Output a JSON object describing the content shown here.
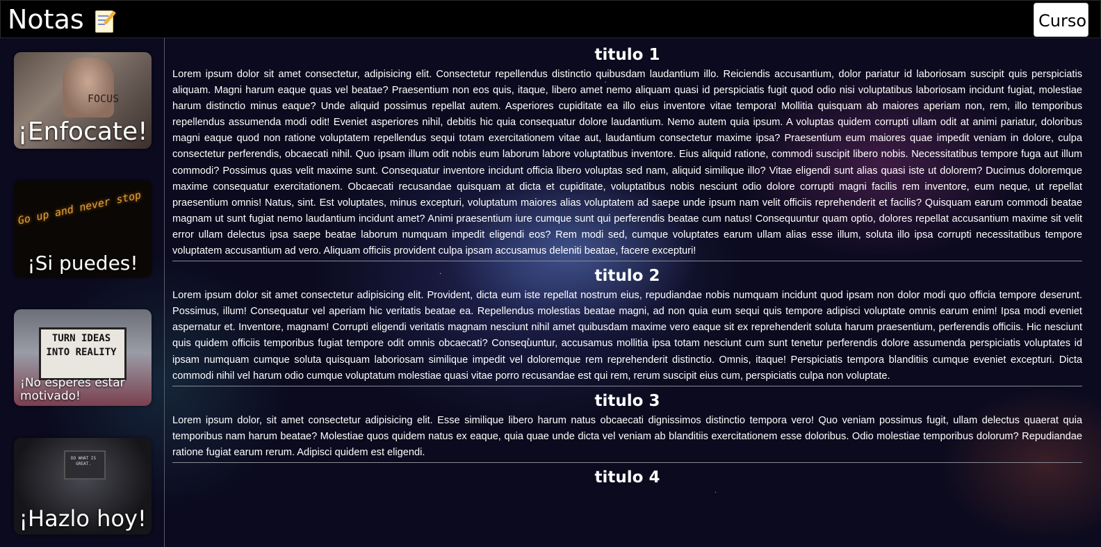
{
  "header": {
    "title": "Notas",
    "title_icon": "memo-icon",
    "course_button": "Curso",
    "background_color": "#000000"
  },
  "sidebar": {
    "cards": [
      {
        "caption": "¡Enfocate!",
        "image_text": "FOCUS",
        "icon": "fist-photo"
      },
      {
        "caption": "¡Si puedes!",
        "image_text": "Go up and never stop",
        "icon": "neon-sign-photo"
      },
      {
        "caption": "¡No esperes estar motivado!",
        "image_text": "TURN IDEAS INTO REALITY",
        "icon": "lightbox-photo"
      },
      {
        "caption": "¡Hazlo hoy!",
        "image_text": "DO WHAT IS GREAT.",
        "icon": "monitor-photo"
      }
    ]
  },
  "notes": [
    {
      "title": "titulo 1",
      "body": "Lorem ipsum dolor sit amet consectetur, adipisicing elit. Consectetur repellendus distinctio quibusdam laudantium illo. Reiciendis accusantium, dolor pariatur id laboriosam suscipit quis perspiciatis aliquam. Magni harum eaque quas vel beatae? Praesentium non eos quis, itaque, libero amet nemo aliquam quasi id perspiciatis fugit quod odio nisi voluptatibus laboriosam incidunt fugiat, molestiae harum distinctio minus eaque? Unde aliquid possimus repellat autem. Asperiores cupiditate ea illo eius inventore vitae tempora! Mollitia quisquam ab maiores aperiam non, rem, illo temporibus repellendus assumenda modi odit! Eveniet asperiores nihil, debitis hic quia consequatur dolore laudantium. Nemo autem quia ipsum. A voluptas quidem corrupti ullam odit at animi pariatur, doloribus magni eaque quod non ratione voluptatem repellendus sequi totam exercitationem vitae aut, laudantium consectetur maxime ipsa? Praesentium eum maiores quae impedit veniam in dolore, culpa consectetur perferendis, obcaecati nihil. Quo ipsam illum odit nobis eum laborum labore voluptatibus inventore. Eius aliquid ratione, commodi suscipit libero nobis. Necessitatibus tempore fuga aut illum commodi? Possimus quas velit maxime sunt. Consequatur inventore incidunt officia libero voluptas sed nam, aliquid similique illo? Vitae eligendi sunt alias quasi iste ut dolorem? Ducimus doloremque maxime consequatur exercitationem. Obcaecati recusandae quisquam at dicta et cupiditate, voluptatibus nobis nesciunt odio dolore corrupti magni facilis rem inventore, eum neque, ut repellat praesentium omnis! Natus, sint. Est voluptates, minus excepturi, voluptatum maiores alias voluptatem ad saepe unde ipsum nam velit officiis reprehenderit et facilis? Quisquam earum commodi beatae magnam ut sunt fugiat nemo laudantium incidunt amet? Animi praesentium iure cumque sunt qui perferendis beatae cum natus! Consequuntur quam optio, dolores repellat accusantium maxime sit velit error ullam delectus ipsa saepe beatae laborum numquam impedit eligendi eos? Rem modi sed, cumque voluptates earum ullam alias esse illum, soluta illo ipsa corrupti necessitatibus tempore voluptatem accusantium ad vero. Aliquam officiis provident culpa ipsam accusamus deleniti beatae, facere excepturi!"
    },
    {
      "title": "titulo 2",
      "body": "Lorem ipsum dolor sit amet consectetur adipisicing elit. Provident, dicta eum iste repellat nostrum eius, repudiandae nobis numquam incidunt quod ipsam non dolor modi quo officia tempore deserunt. Possimus, illum! Consequatur vel aperiam hic veritatis beatae ea. Repellendus molestias beatae magni, ad non quia eum sequi quis tempore adipisci voluptate omnis earum enim! Ipsa modi eveniet aspernatur et. Inventore, magnam! Corrupti eligendi veritatis magnam nesciunt nihil amet quibusdam maxime vero eaque sit ex reprehenderit soluta harum praesentium, perferendis officiis. Hic nesciunt quis quidem officiis temporibus fugiat tempore odit omnis obcaecati? Consequuntur, accusamus mollitia ipsa totam nesciunt cum sunt tenetur perferendis dolore assumenda perspiciatis voluptates id ipsam numquam cumque soluta quisquam laboriosam similique impedit vel doloremque rem reprehenderit distinctio. Omnis, itaque! Perspiciatis tempora blanditiis cumque eveniet excepturi. Dicta commodi nihil vel harum odio cumque voluptatum molestiae quasi vitae porro recusandae est qui rem, rerum suscipit eius cum, perspiciatis culpa non voluptate."
    },
    {
      "title": "titulo 3",
      "body": "Lorem ipsum dolor, sit amet consectetur adipisicing elit. Esse similique libero harum natus obcaecati dignissimos distinctio tempora vero! Quo veniam possimus fugit, ullam delectus quaerat quia temporibus nam harum beatae? Molestiae quos quidem natus ex eaque, quia quae unde dicta vel veniam ab blanditiis exercitationem esse doloribus. Odio molestiae temporibus dolorum? Repudiandae ratione fugiat earum rerum. Adipisci quidem est eligendi."
    },
    {
      "title": "titulo 4",
      "body": ""
    }
  ]
}
